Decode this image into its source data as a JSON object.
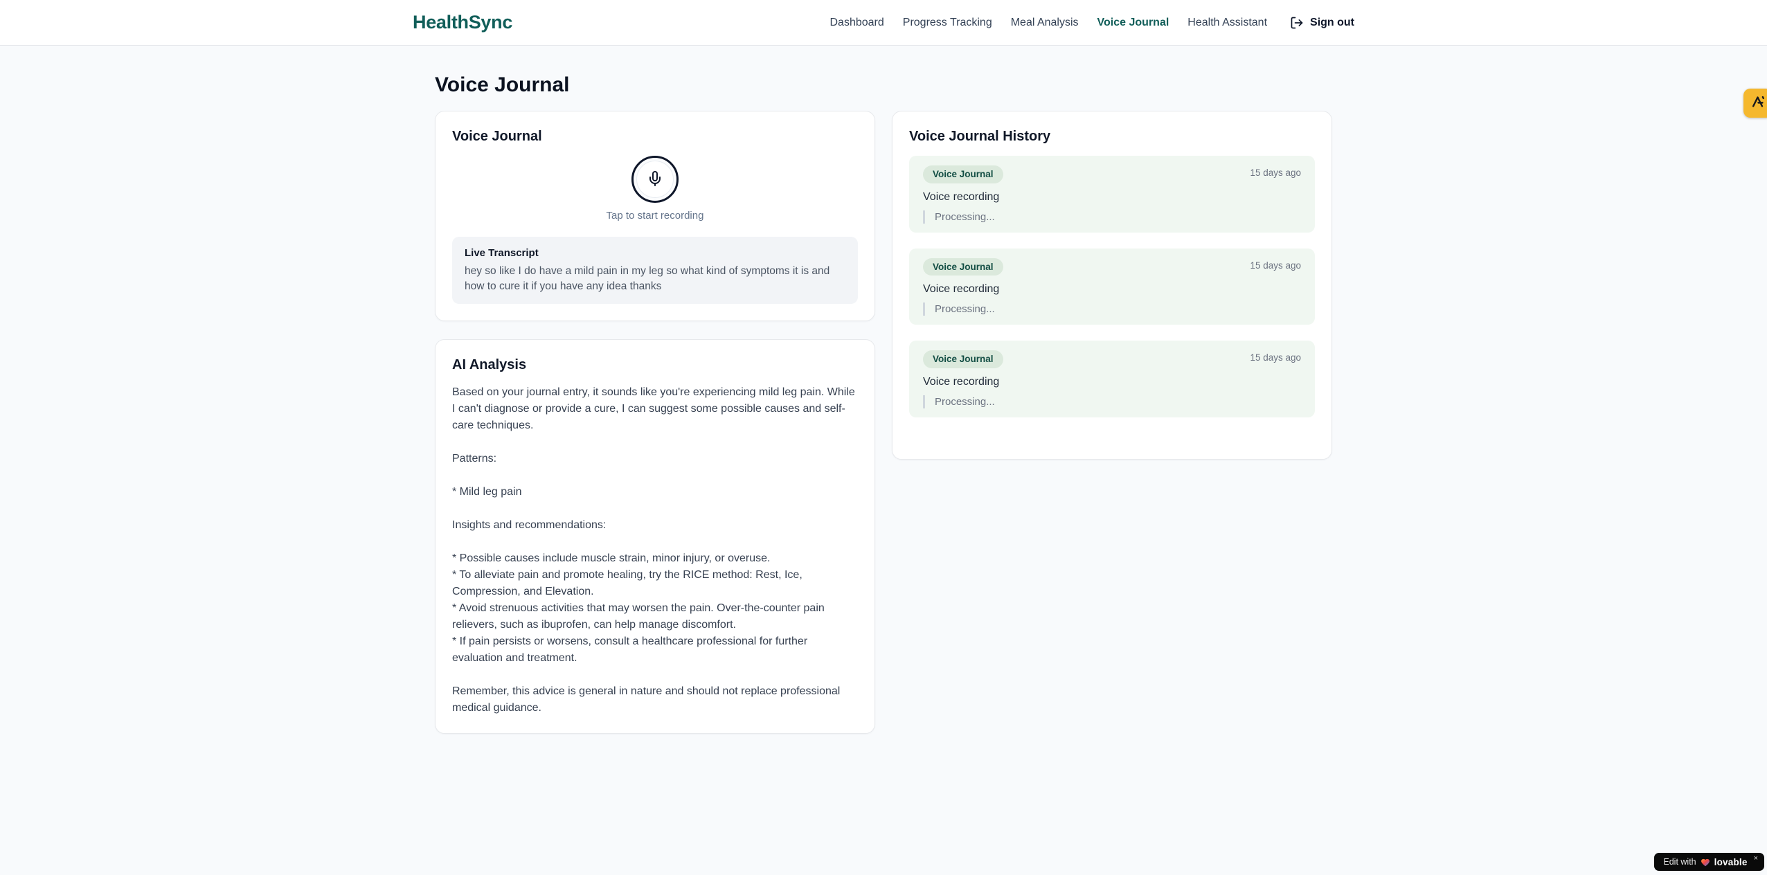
{
  "app": {
    "brand": "HealthSync"
  },
  "nav": {
    "items": [
      {
        "label": "Dashboard",
        "active": false
      },
      {
        "label": "Progress Tracking",
        "active": false
      },
      {
        "label": "Meal Analysis",
        "active": false
      },
      {
        "label": "Voice Journal",
        "active": true
      },
      {
        "label": "Health Assistant",
        "active": false
      }
    ],
    "signout_label": "Sign out"
  },
  "page": {
    "title": "Voice Journal"
  },
  "recorder": {
    "card_title": "Voice Journal",
    "tap_hint": "Tap to start recording",
    "transcript_label": "Live Transcript",
    "transcript_text": "hey so like I do have a mild pain in my leg so what kind of symptoms it is and how to cure it if you have any idea thanks"
  },
  "analysis": {
    "card_title": "AI Analysis",
    "text": "Based on your journal entry, it sounds like you're experiencing mild leg pain. While I can't diagnose or provide a cure, I can suggest some possible causes and self-care techniques.\n\nPatterns:\n\n* Mild leg pain\n\nInsights and recommendations:\n\n* Possible causes include muscle strain, minor injury, or overuse.\n* To alleviate pain and promote healing, try the RICE method: Rest, Ice, Compression, and Elevation.\n* Avoid strenuous activities that may worsen the pain. Over-the-counter pain relievers, such as ibuprofen, can help manage discomfort.\n* If pain persists or worsens, consult a healthcare professional for further evaluation and treatment.\n\nRemember, this advice is general in nature and should not replace professional medical guidance."
  },
  "history": {
    "card_title": "Voice Journal History",
    "items": [
      {
        "badge": "Voice Journal",
        "time": "15 days ago",
        "title": "Voice recording",
        "status": "Processing..."
      },
      {
        "badge": "Voice Journal",
        "time": "15 days ago",
        "title": "Voice recording",
        "status": "Processing..."
      },
      {
        "badge": "Voice Journal",
        "time": "15 days ago",
        "title": "Voice recording",
        "status": "Processing..."
      }
    ]
  },
  "badges": {
    "lovable": {
      "prefix": "Edit with",
      "brand": "lovable",
      "close": "×"
    }
  },
  "colors": {
    "brand_teal": "#115e59",
    "page_bg": "#f8fafc",
    "history_entry_bg": "#f0f7f1",
    "badge_pill_bg": "#dbe9dc",
    "badge_pill_text": "#134e44",
    "extension_badge_amber": "#f5b82e",
    "muted_text": "#6b7280"
  }
}
